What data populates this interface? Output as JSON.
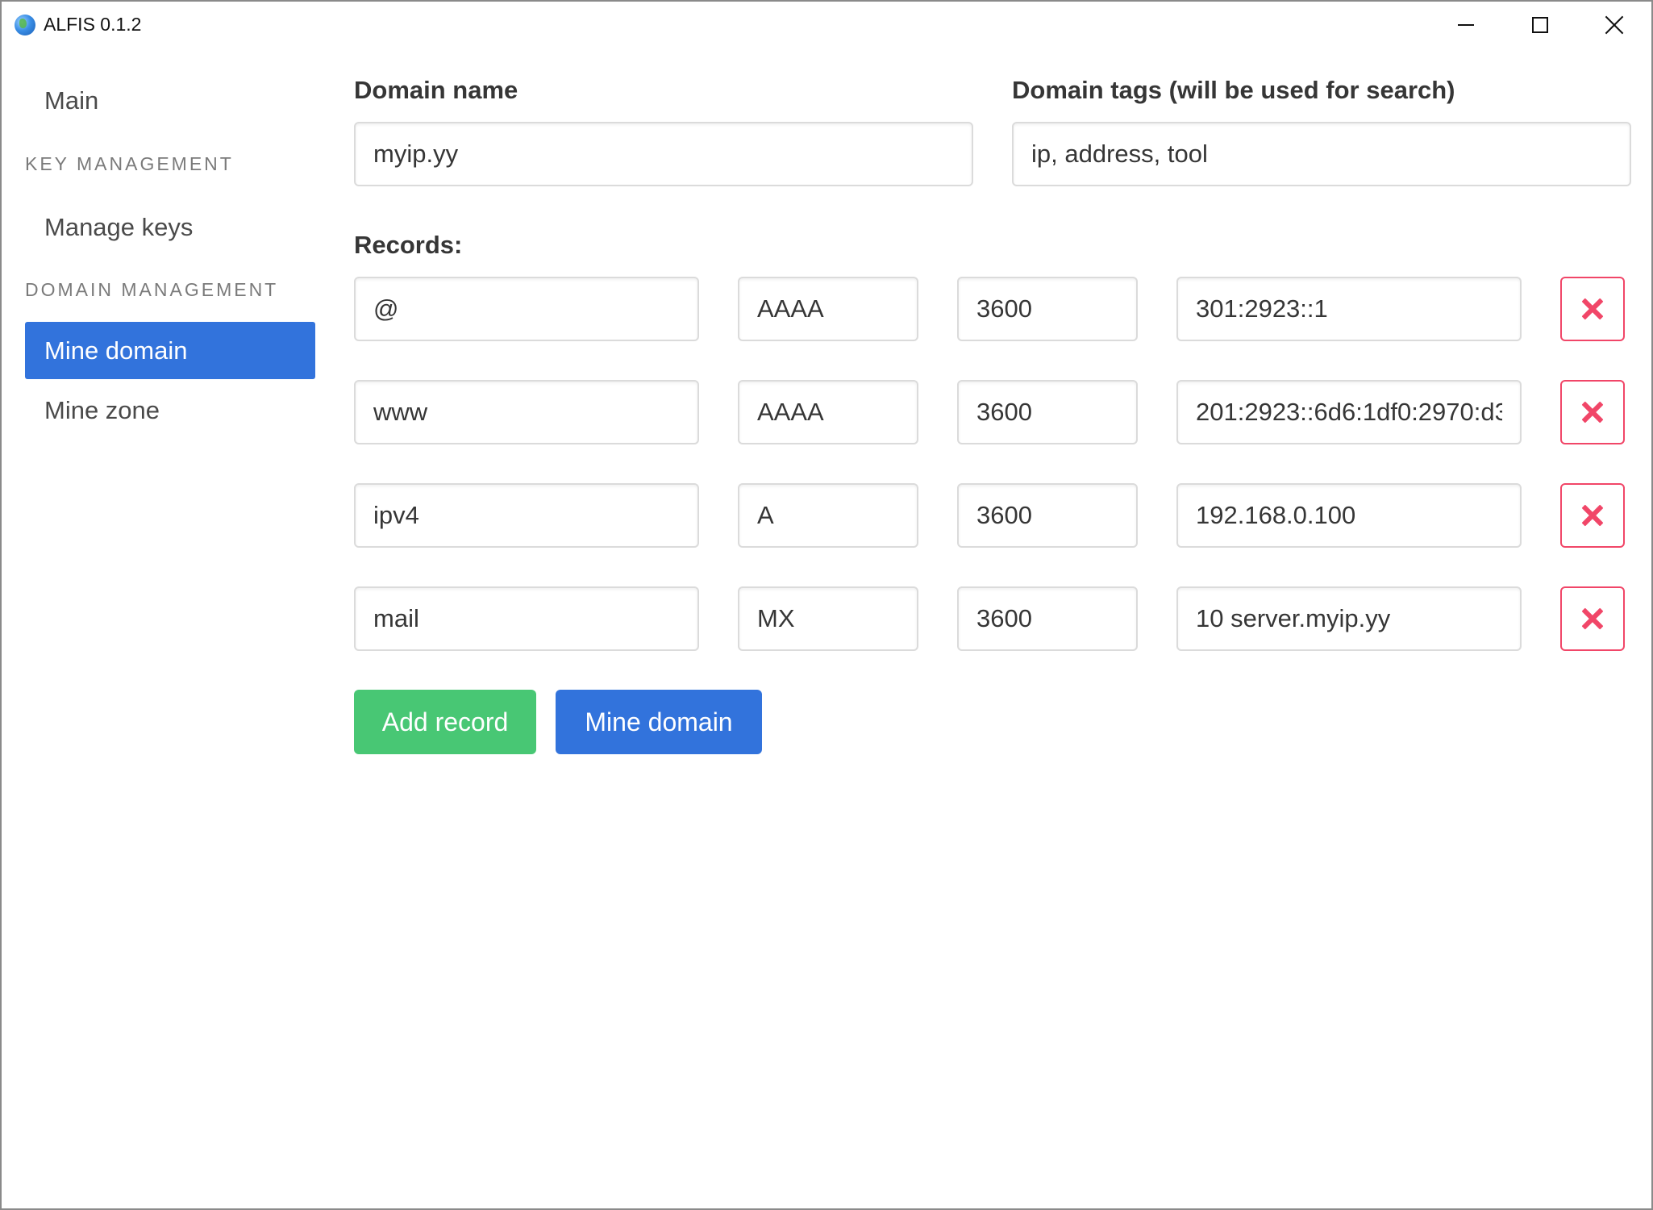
{
  "window": {
    "title": "ALFIS 0.1.2",
    "icon": "globe-icon"
  },
  "sidebar": {
    "main": "Main",
    "key_section": "KEY MANAGEMENT",
    "manage_keys": "Manage keys",
    "domain_section": "DOMAIN MANAGEMENT",
    "mine_domain": "Mine domain",
    "mine_zone": "Mine zone",
    "active_item": "Mine domain"
  },
  "form": {
    "domain_name_label": "Domain name",
    "domain_name_value": "myip.yy",
    "domain_tags_label": "Domain tags (will be used for search)",
    "domain_tags_value": "ip, address, tool",
    "records_label": "Records:"
  },
  "records": [
    {
      "name": "@",
      "type": "AAAA",
      "ttl": "3600",
      "value": "301:2923::1"
    },
    {
      "name": "www",
      "type": "AAAA",
      "ttl": "3600",
      "value": "201:2923::6d6:1df0:2970:d3"
    },
    {
      "name": "ipv4",
      "type": "A",
      "ttl": "3600",
      "value": "192.168.0.100"
    },
    {
      "name": "mail",
      "type": "MX",
      "ttl": "3600",
      "value": "10 server.myip.yy"
    }
  ],
  "actions": {
    "add_record": "Add record",
    "mine_domain": "Mine domain"
  },
  "colors": {
    "primary": "#3273dc",
    "success": "#48c774",
    "danger": "#f14668",
    "border": "#dbdbdb"
  }
}
